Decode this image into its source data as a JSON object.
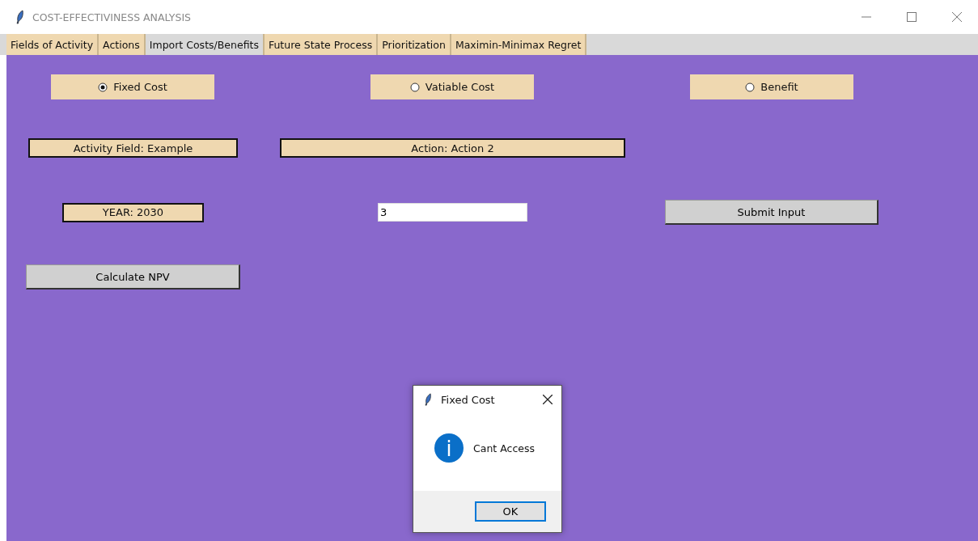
{
  "window": {
    "title": "COST-EFFECTIVINESS ANALYSIS"
  },
  "tabs": [
    {
      "label": "Fields of Activity",
      "selected": false
    },
    {
      "label": "Actions",
      "selected": false
    },
    {
      "label": "Import Costs/Benefits",
      "selected": true
    },
    {
      "label": "Future State Process",
      "selected": false
    },
    {
      "label": "Prioritization",
      "selected": false
    },
    {
      "label": "Maximin-Minimax Regret",
      "selected": false
    }
  ],
  "radios": [
    {
      "label": "Fixed Cost",
      "selected": true
    },
    {
      "label": "Vatiable Cost",
      "selected": false
    },
    {
      "label": "Benefit",
      "selected": false
    }
  ],
  "activity_label": "Activity Field: Example",
  "action_label": "Action: Action 2",
  "year_label": "YEAR: 2030",
  "input": {
    "value": "3"
  },
  "submit_button": "Submit Input",
  "calculate_button": "Calculate NPV",
  "dialog": {
    "title": "Fixed Cost",
    "message": "Cant Access",
    "button": "OK"
  }
}
